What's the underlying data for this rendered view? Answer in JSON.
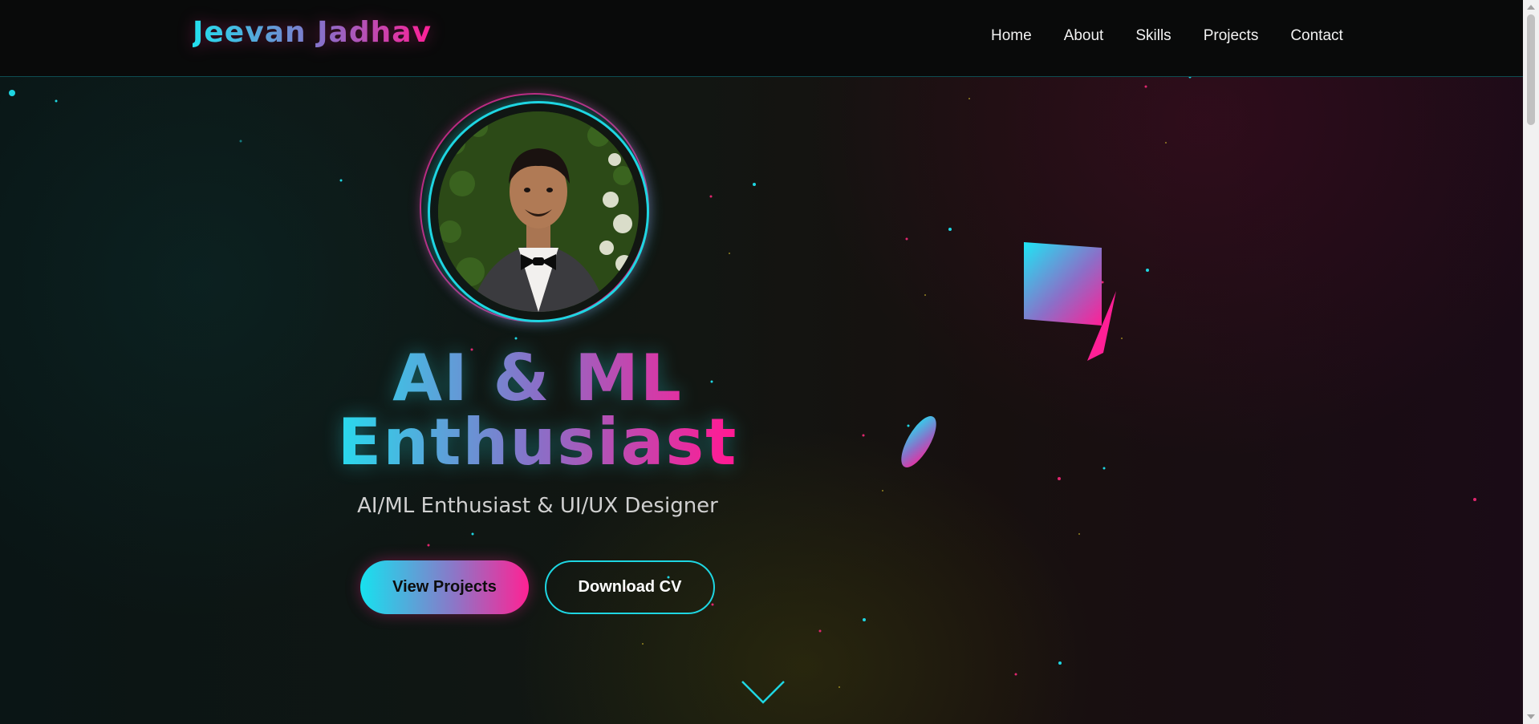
{
  "brand": {
    "name": "Jeevan Jadhav"
  },
  "nav": {
    "items": [
      "Home",
      "About",
      "Skills",
      "Projects",
      "Contact"
    ]
  },
  "hero": {
    "headline_line1": "AI & ML",
    "headline_line2": "Enthusiast",
    "subtitle": "AI/ML Enthusiast & UI/UX Designer",
    "primary_button": "View Projects",
    "secondary_button": "Download CV"
  },
  "icons": {
    "scroll_down": "chevron-down-icon",
    "avatar": "profile-photo"
  },
  "colors": {
    "accent_cyan": "#1ed6e2",
    "accent_pink": "#ff1f96",
    "accent_purple": "#8b6dc8",
    "background": "#0b0d0d"
  }
}
